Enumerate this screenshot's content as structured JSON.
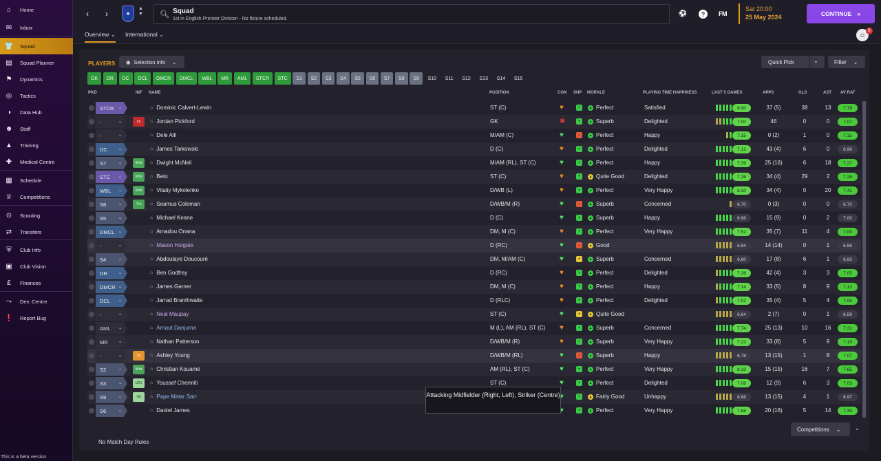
{
  "sidebar": {
    "items": [
      {
        "label": "Home",
        "icon": "home-icon",
        "glyph": "⌂"
      },
      {
        "label": "Inbox",
        "icon": "inbox-icon",
        "glyph": "✉"
      },
      {
        "label": "Squad",
        "icon": "shirt-icon",
        "glyph": "👕",
        "active": true
      },
      {
        "label": "Squad Planner",
        "icon": "planner-icon",
        "glyph": "▤"
      },
      {
        "label": "Dynamics",
        "icon": "dynamics-icon",
        "glyph": "⚑"
      },
      {
        "label": "Tactics",
        "icon": "tactics-icon",
        "glyph": "◎"
      },
      {
        "label": "Data Hub",
        "icon": "data-hub-icon",
        "glyph": "◑"
      },
      {
        "label": "Staff",
        "icon": "staff-icon",
        "glyph": "☻"
      },
      {
        "label": "Training",
        "icon": "training-icon",
        "glyph": "▲"
      },
      {
        "label": "Medical Centre",
        "icon": "medical-icon",
        "glyph": "✚"
      },
      {
        "label": "Schedule",
        "icon": "schedule-icon",
        "glyph": "▦"
      },
      {
        "label": "Competitions",
        "icon": "trophy-icon",
        "glyph": "♕"
      },
      {
        "label": "Scouting",
        "icon": "scouting-icon",
        "glyph": "⊙"
      },
      {
        "label": "Transfers",
        "icon": "transfers-icon",
        "glyph": "⇄"
      },
      {
        "label": "Club Info",
        "icon": "club-info-icon",
        "glyph": "⛨"
      },
      {
        "label": "Club Vision",
        "icon": "club-vision-icon",
        "glyph": "▣"
      },
      {
        "label": "Finances",
        "icon": "finances-icon",
        "glyph": "£"
      },
      {
        "label": "Dev. Centre",
        "icon": "dev-centre-icon",
        "glyph": "⤳"
      },
      {
        "label": "Report Bug",
        "icon": "report-bug-icon",
        "glyph": "❗"
      }
    ],
    "beta_note": "This is a beta version"
  },
  "header": {
    "search_title": "Squad",
    "search_subtitle": "1st in English Premier Division - No fixture scheduled.",
    "fm_logo": "FM",
    "date_time": "Sat 20:00",
    "date_day": "25 May 2024",
    "continue_label": "CONTINUE",
    "notification_count": "6"
  },
  "tabs": [
    {
      "label": "Overview"
    },
    {
      "label": "International"
    }
  ],
  "panel": {
    "title": "PLAYERS",
    "selection_info": "Selection Info",
    "quick_pick": "Quick Pick",
    "filter": "Filter",
    "position_chips_green": [
      "GK",
      "DR",
      "DC",
      "DCL",
      "DMCR",
      "DMCL",
      "WBL",
      "MR",
      "AML",
      "STCR",
      "STC"
    ],
    "position_chips_grey": [
      "S1",
      "S2",
      "S3",
      "S4",
      "S5",
      "S6",
      "S7",
      "S8",
      "S9"
    ],
    "position_chips_plain": [
      "S10",
      "S11",
      "S12",
      "S13",
      "S14",
      "S15"
    ],
    "columns": {
      "pkd": "PKD",
      "inf": "INF",
      "name": "NAME",
      "position": "POSITION",
      "con": "CON",
      "shp": "SHP",
      "morale": "MORALE",
      "happiness": "PLAYING TIME HAPPINESS",
      "form": "LAST 5 GAMES",
      "apps": "APPS",
      "gls": "GLS",
      "ast": "AST",
      "avrat": "AV RAT"
    },
    "no_match_rules": "No Match Day Rules",
    "competitions": "Competitions",
    "tooltip": "Attacking Midfielder (Right, Left), Striker (Centre)"
  },
  "players": [
    {
      "pick": "STCR",
      "pill": "purple",
      "inf": "",
      "name": "Dominic Calvert-Lewin",
      "nc": "",
      "position": "ST (C)",
      "con": "orange",
      "shp": "green",
      "morale": "Perfect",
      "mc": "green",
      "happiness": "Satisfied",
      "form": [
        "g",
        "g",
        "g",
        "g",
        "g"
      ],
      "rating": "8.00",
      "rc": "#5fd44a",
      "apps": "37 (5)",
      "gls": "38",
      "ast": "13",
      "avrat": "7.78",
      "ac": "#4cc83c"
    },
    {
      "pick": "-",
      "pill": "plain",
      "inf": "Inj",
      "infc": "red",
      "name": "Jordan Pickford",
      "nc": "",
      "position": "GK",
      "con": "red",
      "shp": "green",
      "morale": "Superb",
      "mc": "green",
      "happiness": "Delighted",
      "form": [
        "y",
        "y",
        "g",
        "g",
        "g"
      ],
      "rating": "7.00",
      "rc": "#5fd44a",
      "apps": "46",
      "gls": "0",
      "ast": "0",
      "avrat": "7.07",
      "ac": "#4cc83c"
    },
    {
      "pick": "-",
      "pill": "plain",
      "inf": "",
      "name": "Dele Alli",
      "nc": "",
      "position": "M/AM (C)",
      "con": "green",
      "shp": "red",
      "morale": "Perfect",
      "mc": "green",
      "happiness": "Happy",
      "form": [
        "y",
        "g"
      ],
      "rating": "7.15",
      "rc": "#5fd44a",
      "apps": "0 (2)",
      "gls": "1",
      "ast": "0",
      "avrat": "7.15",
      "ac": "#4cc83c"
    },
    {
      "pick": "DC",
      "pill": "blue",
      "inf": "",
      "name": "James Tarkowski",
      "nc": "",
      "position": "D (C)",
      "con": "orange",
      "shp": "green",
      "morale": "Perfect",
      "mc": "green",
      "happiness": "Delighted",
      "form": [
        "g",
        "g",
        "g",
        "g",
        "g"
      ],
      "rating": "7.12",
      "rc": "#5fd44a",
      "apps": "43 (4)",
      "gls": "6",
      "ast": "0",
      "avrat": "6.96",
      "ac": "#3a3945"
    },
    {
      "pick": "S7",
      "pill": "slate",
      "inf": "Wnt",
      "infc": "green",
      "name": "Dwight McNeil",
      "nc": "",
      "position": "M/AM (RL), ST (C)",
      "con": "green",
      "shp": "green",
      "morale": "Perfect",
      "mc": "green",
      "happiness": "Happy",
      "form": [
        "g",
        "g",
        "g",
        "g",
        "g"
      ],
      "rating": "7.39",
      "rc": "#5fd44a",
      "apps": "25 (16)",
      "gls": "6",
      "ast": "18",
      "avrat": "7.27",
      "ac": "#4cc83c"
    },
    {
      "pick": "STC",
      "pill": "purple",
      "inf": "Wnt",
      "infc": "green",
      "name": "Beto",
      "nc": "",
      "position": "ST (C)",
      "con": "orange",
      "shp": "green",
      "morale": "Quite Good",
      "mc": "yellow",
      "happiness": "Delighted",
      "form": [
        "g",
        "g",
        "g",
        "g",
        "g"
      ],
      "rating": "7.26",
      "rc": "#5fd44a",
      "apps": "34 (4)",
      "gls": "29",
      "ast": "2",
      "avrat": "7.26",
      "ac": "#4cc83c"
    },
    {
      "pick": "WBL",
      "pill": "blue",
      "inf": "Wnt",
      "infc": "green",
      "name": "Vitaliy Mykolenko",
      "nc": "",
      "position": "D/WB (L)",
      "con": "orange",
      "shp": "green",
      "morale": "Perfect",
      "mc": "green",
      "happiness": "Very Happy",
      "form": [
        "g",
        "g",
        "g",
        "g",
        "g"
      ],
      "rating": "8.10",
      "rc": "#5fd44a",
      "apps": "34 (4)",
      "gls": "0",
      "ast": "20",
      "avrat": "7.41",
      "ac": "#4cc83c"
    },
    {
      "pick": "S8",
      "pill": "slate",
      "inf": "Trn",
      "infc": "green",
      "name": "Seamus Coleman",
      "nc": "",
      "position": "D/WB/M (R)",
      "con": "green",
      "shp": "red",
      "morale": "Superb",
      "mc": "green",
      "happiness": "Concerned",
      "form": [
        "y"
      ],
      "rating": "6.70",
      "rc": "#3a3945",
      "apps": "0 (3)",
      "gls": "0",
      "ast": "0",
      "avrat": "6.70",
      "ac": "#3a3945"
    },
    {
      "pick": "S5",
      "pill": "slate",
      "inf": "",
      "name": "Michael Keane",
      "nc": "",
      "position": "D (C)",
      "con": "green",
      "shp": "green",
      "morale": "Superb",
      "mc": "green",
      "happiness": "Happy",
      "form": [
        "g",
        "g",
        "g",
        "g",
        "g"
      ],
      "rating": "6.96",
      "rc": "#3a3945",
      "apps": "15 (9)",
      "gls": "0",
      "ast": "2",
      "avrat": "7.00",
      "ac": "#3a3945"
    },
    {
      "pick": "DMCL",
      "pill": "blue",
      "inf": "",
      "name": "Amadou Onana",
      "nc": "",
      "position": "DM, M (C)",
      "con": "orange",
      "shp": "green",
      "morale": "Perfect",
      "mc": "green",
      "happiness": "Very Happy",
      "form": [
        "g",
        "g",
        "g",
        "g",
        "g"
      ],
      "rating": "7.52",
      "rc": "#5fd44a",
      "apps": "35 (7)",
      "gls": "11",
      "ast": "4",
      "avrat": "7.09",
      "ac": "#4cc83c"
    },
    {
      "pick": "-",
      "pill": "plain",
      "inf": "",
      "name": "Mason Holgate",
      "nc": "purple",
      "position": "D (RC)",
      "con": "green",
      "shp": "red",
      "morale": "Good",
      "mc": "yellow",
      "happiness": "",
      "form": [
        "y",
        "y",
        "y",
        "y",
        "y"
      ],
      "rating": "6.84",
      "rc": "#3a3945",
      "apps": "14 (14)",
      "gls": "0",
      "ast": "1",
      "avrat": "6.96",
      "ac": "#3a3945"
    },
    {
      "pick": "S4",
      "pill": "slate",
      "inf": "",
      "name": "Abdoulaye Doucouré",
      "nc": "",
      "position": "DM, M/AM (C)",
      "con": "green",
      "shp": "yellow",
      "morale": "Superb",
      "mc": "green",
      "happiness": "Concerned",
      "form": [
        "y",
        "y",
        "y",
        "y",
        "y"
      ],
      "rating": "6.80",
      "rc": "#3a3945",
      "apps": "17 (8)",
      "gls": "6",
      "ast": "1",
      "avrat": "6.93",
      "ac": "#3a3945"
    },
    {
      "pick": "DR",
      "pill": "blue",
      "inf": "",
      "name": "Ben Godfrey",
      "nc": "",
      "position": "D (RC)",
      "con": "orange",
      "shp": "green",
      "morale": "Perfect",
      "mc": "green",
      "happiness": "Delighted",
      "form": [
        "y",
        "g",
        "g",
        "g",
        "g"
      ],
      "rating": "7.26",
      "rc": "#5fd44a",
      "apps": "42 (4)",
      "gls": "3",
      "ast": "3",
      "avrat": "7.05",
      "ac": "#4cc83c"
    },
    {
      "pick": "DMCR",
      "pill": "blue",
      "inf": "",
      "name": "James Garner",
      "nc": "",
      "position": "DM, M (C)",
      "con": "orange",
      "shp": "green",
      "morale": "Perfect",
      "mc": "green",
      "happiness": "Happy",
      "form": [
        "y",
        "g",
        "g",
        "g",
        "g"
      ],
      "rating": "7.14",
      "rc": "#5fd44a",
      "apps": "33 (5)",
      "gls": "8",
      "ast": "9",
      "avrat": "7.12",
      "ac": "#4cc83c"
    },
    {
      "pick": "DCL",
      "pill": "blue",
      "inf": "",
      "name": "Jarrad Branthwaite",
      "nc": "",
      "position": "D (RLC)",
      "con": "orange",
      "shp": "green",
      "morale": "Perfect",
      "mc": "green",
      "happiness": "Delighted",
      "form": [
        "y",
        "g",
        "g",
        "g",
        "g"
      ],
      "rating": "7.02",
      "rc": "#5fd44a",
      "apps": "35 (4)",
      "gls": "5",
      "ast": "4",
      "avrat": "7.05",
      "ac": "#4cc83c"
    },
    {
      "pick": "-",
      "pill": "plain",
      "inf": "",
      "name": "Neal Maupay",
      "nc": "purple",
      "position": "ST (C)",
      "con": "green",
      "shp": "yellow",
      "morale": "Quite Good",
      "mc": "yellow",
      "happiness": "",
      "form": [
        "y",
        "y",
        "y",
        "y",
        "y"
      ],
      "rating": "6.64",
      "rc": "#3a3945",
      "apps": "2 (7)",
      "gls": "0",
      "ast": "1",
      "avrat": "6.59",
      "ac": "#3a3945"
    },
    {
      "pick": "AML",
      "pill": "plain",
      "inf": "",
      "name": "Arnaut Danjuma",
      "nc": "blue",
      "position": "M (L), AM (RL), ST (C)",
      "con": "orange",
      "shp": "green",
      "morale": "Superb",
      "mc": "green",
      "happiness": "Concerned",
      "form": [
        "g",
        "g",
        "g",
        "g",
        "g"
      ],
      "rating": "7.74",
      "rc": "#5fd44a",
      "apps": "25 (13)",
      "gls": "10",
      "ast": "16",
      "avrat": "7.31",
      "ac": "#4cc83c"
    },
    {
      "pick": "MR",
      "pill": "plain",
      "inf": "",
      "name": "Nathan Patterson",
      "nc": "",
      "position": "D/WB/M (R)",
      "con": "orange",
      "shp": "green",
      "morale": "Superb",
      "mc": "green",
      "happiness": "Very Happy",
      "form": [
        "g",
        "g",
        "g",
        "g",
        "g"
      ],
      "rating": "7.22",
      "rc": "#5fd44a",
      "apps": "33 (8)",
      "gls": "5",
      "ast": "9",
      "avrat": "7.15",
      "ac": "#4cc83c"
    },
    {
      "pick": "-",
      "pill": "plain",
      "inf": "Inj",
      "infc": "orange",
      "name": "Ashley Young",
      "nc": "",
      "position": "D/WB/M (RL)",
      "con": "green",
      "shp": "red",
      "morale": "Superb",
      "mc": "green",
      "happiness": "Happy",
      "form": [
        "y",
        "y",
        "y",
        "y",
        "y"
      ],
      "rating": "6.78",
      "rc": "#3a3945",
      "apps": "13 (15)",
      "gls": "1",
      "ast": "8",
      "avrat": "7.07",
      "ac": "#4cc83c"
    },
    {
      "pick": "S2",
      "pill": "slate",
      "inf": "Wnt",
      "infc": "green",
      "name": "Christian Kouamé",
      "nc": "",
      "position": "AM (RL), ST (C)",
      "con": "green",
      "shp": "green",
      "morale": "Perfect",
      "mc": "green",
      "happiness": "Very Happy",
      "form": [
        "g",
        "g",
        "g",
        "g",
        "g"
      ],
      "rating": "8.32",
      "rc": "#5fd44a",
      "apps": "15 (15)",
      "gls": "16",
      "ast": "7",
      "avrat": "7.65",
      "ac": "#4cc83c"
    },
    {
      "pick": "S3",
      "pill": "slate",
      "inf": "U21",
      "infc": "lgreen",
      "name": "Youssef Chermiti",
      "nc": "",
      "position": "ST (C)",
      "con": "green",
      "shp": "green",
      "morale": "Perfect",
      "mc": "green",
      "happiness": "Delighted",
      "form": [
        "g",
        "g",
        "g",
        "g",
        "g"
      ],
      "rating": "7.08",
      "rc": "#5fd44a",
      "apps": "12 (9)",
      "gls": "6",
      "ast": "3",
      "avrat": "7.03",
      "ac": "#4cc83c"
    },
    {
      "pick": "S9",
      "pill": "slate",
      "inf": "Slt",
      "infc": "lgreen",
      "name": "Pape Matar Sarr",
      "nc": "blue",
      "position": "AM (RL), ST (C)",
      "con": "green",
      "shp": "green",
      "morale": "Fairly Good",
      "mc": "yellow",
      "happiness": "Unhappy",
      "form": [
        "y",
        "y",
        "y",
        "y",
        "y"
      ],
      "rating": "6.88",
      "rc": "#3a3945",
      "apps": "13 (15)",
      "gls": "4",
      "ast": "1",
      "avrat": "6.97",
      "ac": "#3a3945"
    },
    {
      "pick": "S6",
      "pill": "slate",
      "inf": "",
      "name": "Daniel James",
      "nc": "",
      "position": "",
      "con": "green",
      "shp": "green",
      "morale": "Perfect",
      "mc": "green",
      "happiness": "Very Happy",
      "form": [
        "g",
        "g",
        "g",
        "g",
        "g"
      ],
      "rating": "7.68",
      "rc": "#5fd44a",
      "apps": "20 (16)",
      "gls": "5",
      "ast": "14",
      "avrat": "7.39",
      "ac": "#4cc83c"
    }
  ]
}
